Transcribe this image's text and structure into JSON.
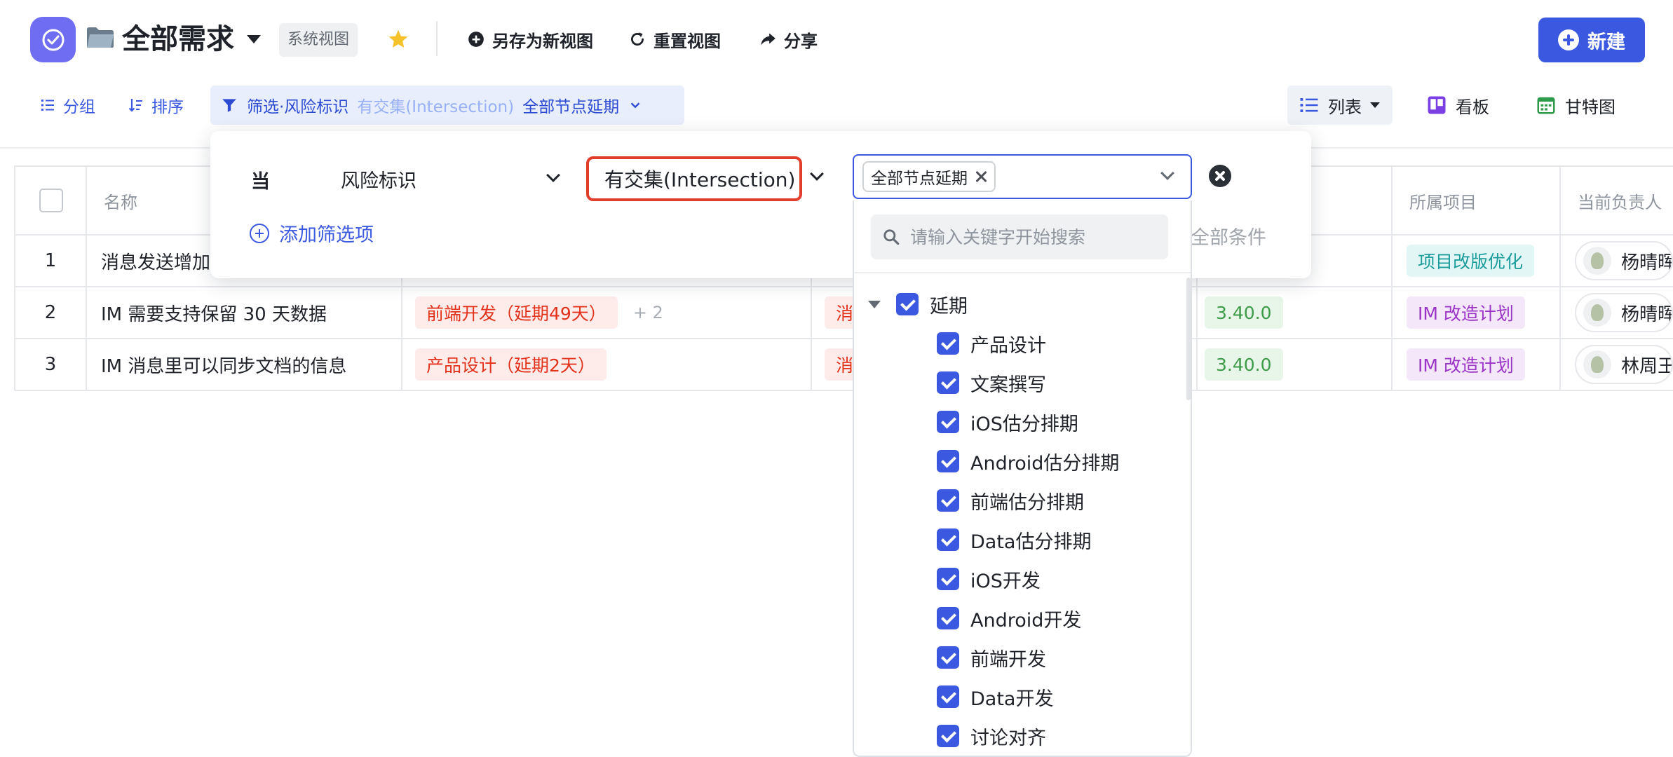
{
  "header": {
    "title": "全部需求",
    "view_badge": "系统视图",
    "save_as_label": "另存为新视图",
    "reset_label": "重置视图",
    "share_label": "分享",
    "new_label": "新建"
  },
  "toolbar": {
    "group_label": "分组",
    "sort_label": "排序",
    "filter": {
      "label": "筛选·风险标识",
      "operator": "有交集(Intersection)",
      "value": "全部节点延期"
    },
    "views": {
      "list_label": "列表",
      "kanban_label": "看板",
      "gantt_label": "甘特图"
    }
  },
  "filter_panel": {
    "when_label": "当",
    "field": "风险标识",
    "operator": "有交集(Intersection)",
    "selected_tag": "全部节点延期",
    "add_filter_label": "添加筛选项",
    "all_conditions_label": "全部条件",
    "search_placeholder": "请输入关键字开始搜索",
    "group_label": "延期",
    "options": [
      "产品设计",
      "文案撰写",
      "iOS估分排期",
      "Android估分排期",
      "前端估分排期",
      "Data估分排期",
      "iOS开发",
      "Android开发",
      "前端开发",
      "Data开发",
      "讨论对齐"
    ]
  },
  "table": {
    "columns": {
      "name": "名称",
      "project": "所属项目",
      "owner": "当前负责人"
    },
    "rows": [
      {
        "index": "1",
        "name": "消息发送增加",
        "project": "项目改版优化",
        "owner": "杨晴晖"
      },
      {
        "index": "2",
        "name": "IM 需要支持保留 30 天数据",
        "risk": "前端开发（延期49天）",
        "risk_more": "+ 2",
        "risk2": "消",
        "version": "3.40.0",
        "project": "IM 改造计划",
        "owner": "杨晴晖"
      },
      {
        "index": "3",
        "name": "IM 消息里可以同步文档的信息",
        "risk": "产品设计（延期2天）",
        "risk2": "消",
        "version": "3.40.0",
        "project": "IM 改造计划",
        "owner": "林周王"
      }
    ]
  },
  "colors": {
    "accent": "#3b59e0",
    "highlight_border": "#e03d2a",
    "logo": "#6f6ef3"
  }
}
